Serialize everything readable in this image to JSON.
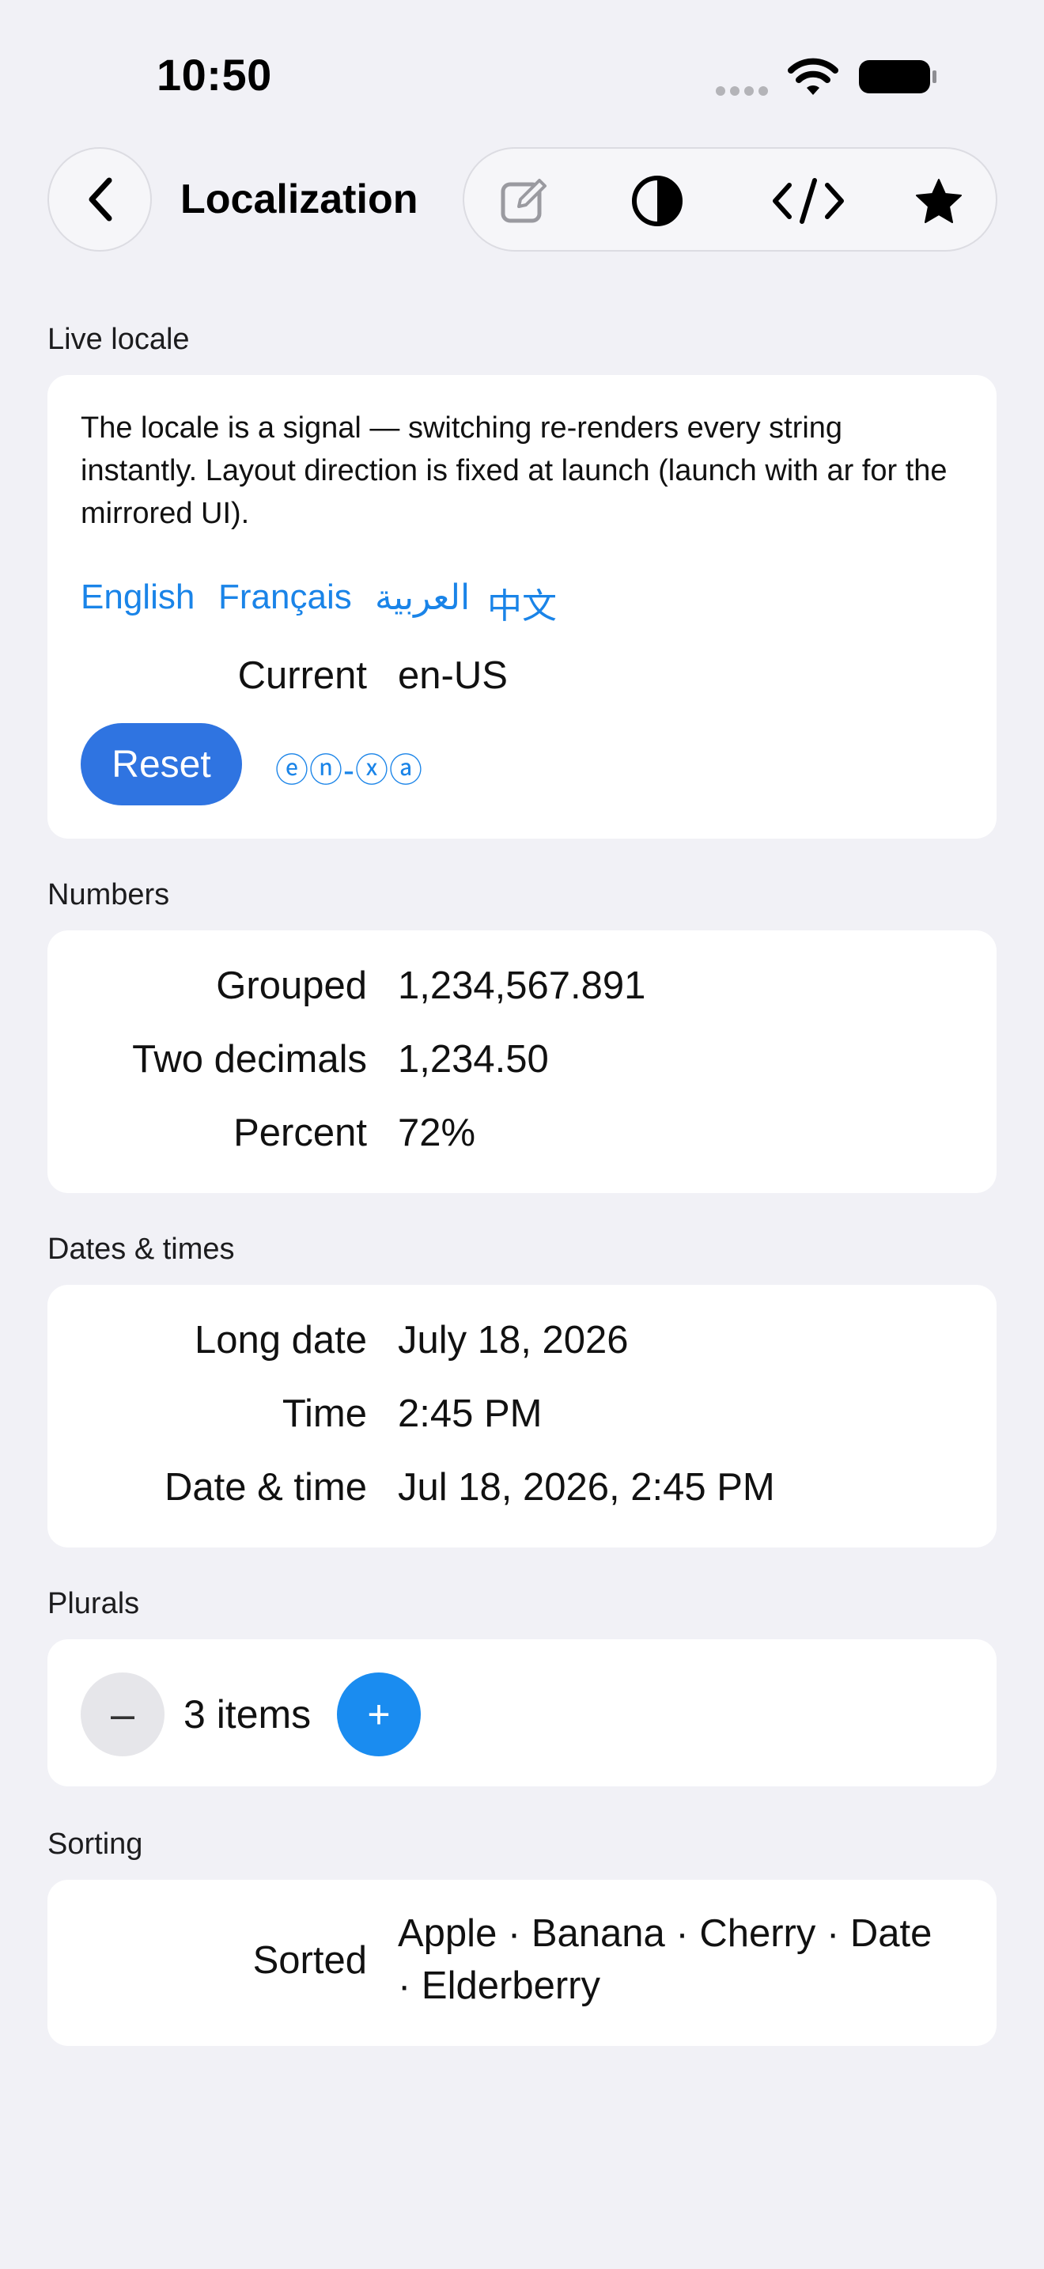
{
  "status": {
    "time": "10:50"
  },
  "nav": {
    "title": "Localization",
    "toolbar_icons": [
      "edit-icon",
      "contrast-icon",
      "code-icon",
      "star-icon"
    ]
  },
  "live_locale": {
    "section_label": "Live locale",
    "description": "The locale is a signal — switching re-renders every string instantly. Layout direction is fixed at launch (launch with ar for the mirrored UI).",
    "languages": [
      "English",
      "Français",
      "العربية",
      "中文"
    ],
    "current_label": "Current",
    "current_value": "en-US",
    "reset_label": "Reset",
    "pseudo_locale": "ⓔⓝ-ⓧⓐ"
  },
  "numbers": {
    "section_label": "Numbers",
    "rows": [
      {
        "label": "Grouped",
        "value": "1,234,567.891"
      },
      {
        "label": "Two decimals",
        "value": "1,234.50"
      },
      {
        "label": "Percent",
        "value": "72%"
      }
    ]
  },
  "dates": {
    "section_label": "Dates & times",
    "rows": [
      {
        "label": "Long date",
        "value": "July 18, 2026"
      },
      {
        "label": "Time",
        "value": "2:45 PM"
      },
      {
        "label": "Date & time",
        "value": "Jul 18, 2026, 2:45 PM"
      }
    ]
  },
  "plurals": {
    "section_label": "Plurals",
    "minus_label": "–",
    "count_text": "3 items",
    "plus_label": "+"
  },
  "sorting": {
    "section_label": "Sorting",
    "label": "Sorted",
    "line1": "Apple · Banana · Cherry · Date",
    "line2": "· Elderberry"
  },
  "colors": {
    "accent": "#1a84e8",
    "reset_button": "#2f74e1",
    "plus_button": "#1a8cf0",
    "background": "#f1f1f6"
  }
}
